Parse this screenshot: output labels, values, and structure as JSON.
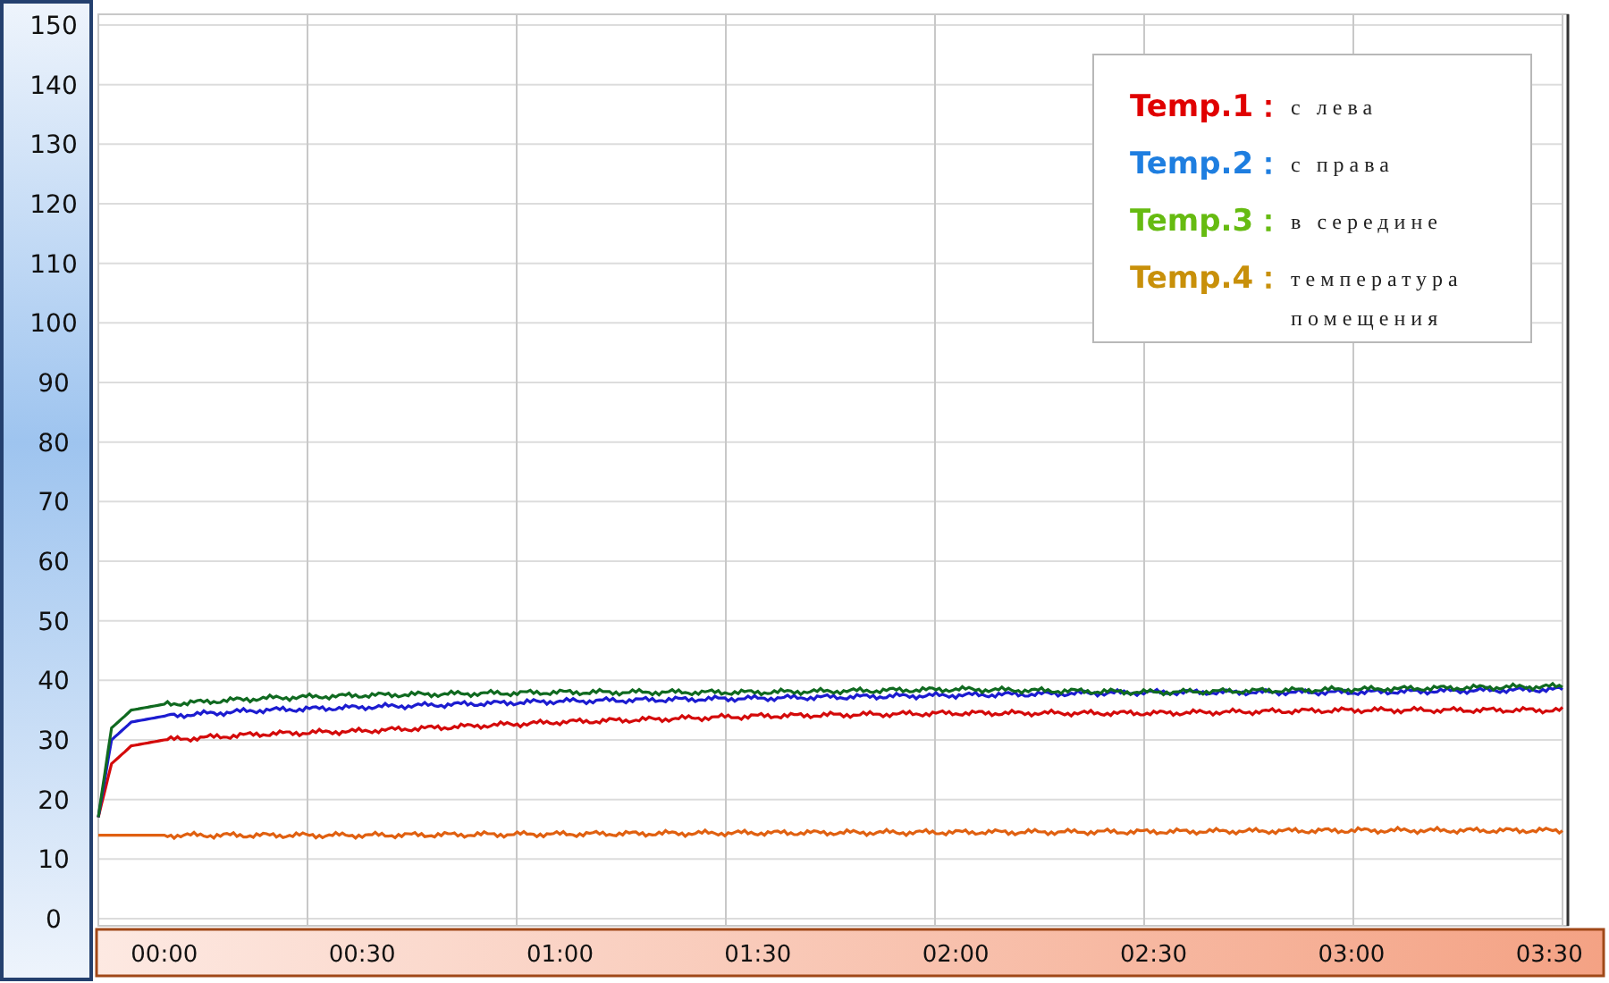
{
  "chart_data": {
    "type": "line",
    "grid": true,
    "x": [
      -10,
      -8,
      -5,
      0,
      15,
      30,
      60,
      90,
      120,
      150,
      180,
      212
    ],
    "xlim": [
      -10,
      212
    ],
    "ylim": [
      0,
      150
    ],
    "xticks": [
      {
        "value": 0,
        "label": "00:00"
      },
      {
        "value": 30,
        "label": "00:30"
      },
      {
        "value": 60,
        "label": "01:00"
      },
      {
        "value": 90,
        "label": "01:30"
      },
      {
        "value": 120,
        "label": "02:00"
      },
      {
        "value": 150,
        "label": "02:30"
      },
      {
        "value": 180,
        "label": "03:00"
      },
      {
        "value": 210,
        "label": "03:30"
      }
    ],
    "yticks": [
      0,
      10,
      20,
      30,
      40,
      50,
      60,
      70,
      80,
      90,
      100,
      110,
      120,
      130,
      140,
      150
    ],
    "series": [
      {
        "name": "Temp.1",
        "color": "#d40a0a",
        "values": [
          17,
          26,
          29,
          30,
          31,
          31.5,
          33,
          34,
          34.5,
          34.5,
          35,
          35
        ]
      },
      {
        "name": "Temp.2",
        "color": "#1c1cd0",
        "values": [
          17,
          30,
          33,
          34,
          35,
          35.5,
          36.5,
          37,
          37.5,
          38,
          38,
          38.5
        ]
      },
      {
        "name": "Temp.3",
        "color": "#106a20",
        "values": [
          17,
          32,
          35,
          36,
          37,
          37.5,
          38,
          38,
          38.5,
          38,
          38.5,
          39
        ]
      },
      {
        "name": "Temp.4",
        "color": "#e06010",
        "values": [
          14,
          14,
          14,
          14,
          14,
          14,
          14.2,
          14.4,
          14.5,
          14.6,
          14.8,
          14.8
        ]
      }
    ]
  },
  "legend": [
    {
      "separator": "：",
      "text": "с лева",
      "color": "#e00000"
    },
    {
      "separator": "：",
      "text": "с права",
      "color": "#1e7ee0"
    },
    {
      "separator": "：",
      "text": "в середине",
      "color": "#66bb11"
    },
    {
      "separator": "：",
      "text": "температура помещения",
      "color": "#c8900a"
    }
  ]
}
